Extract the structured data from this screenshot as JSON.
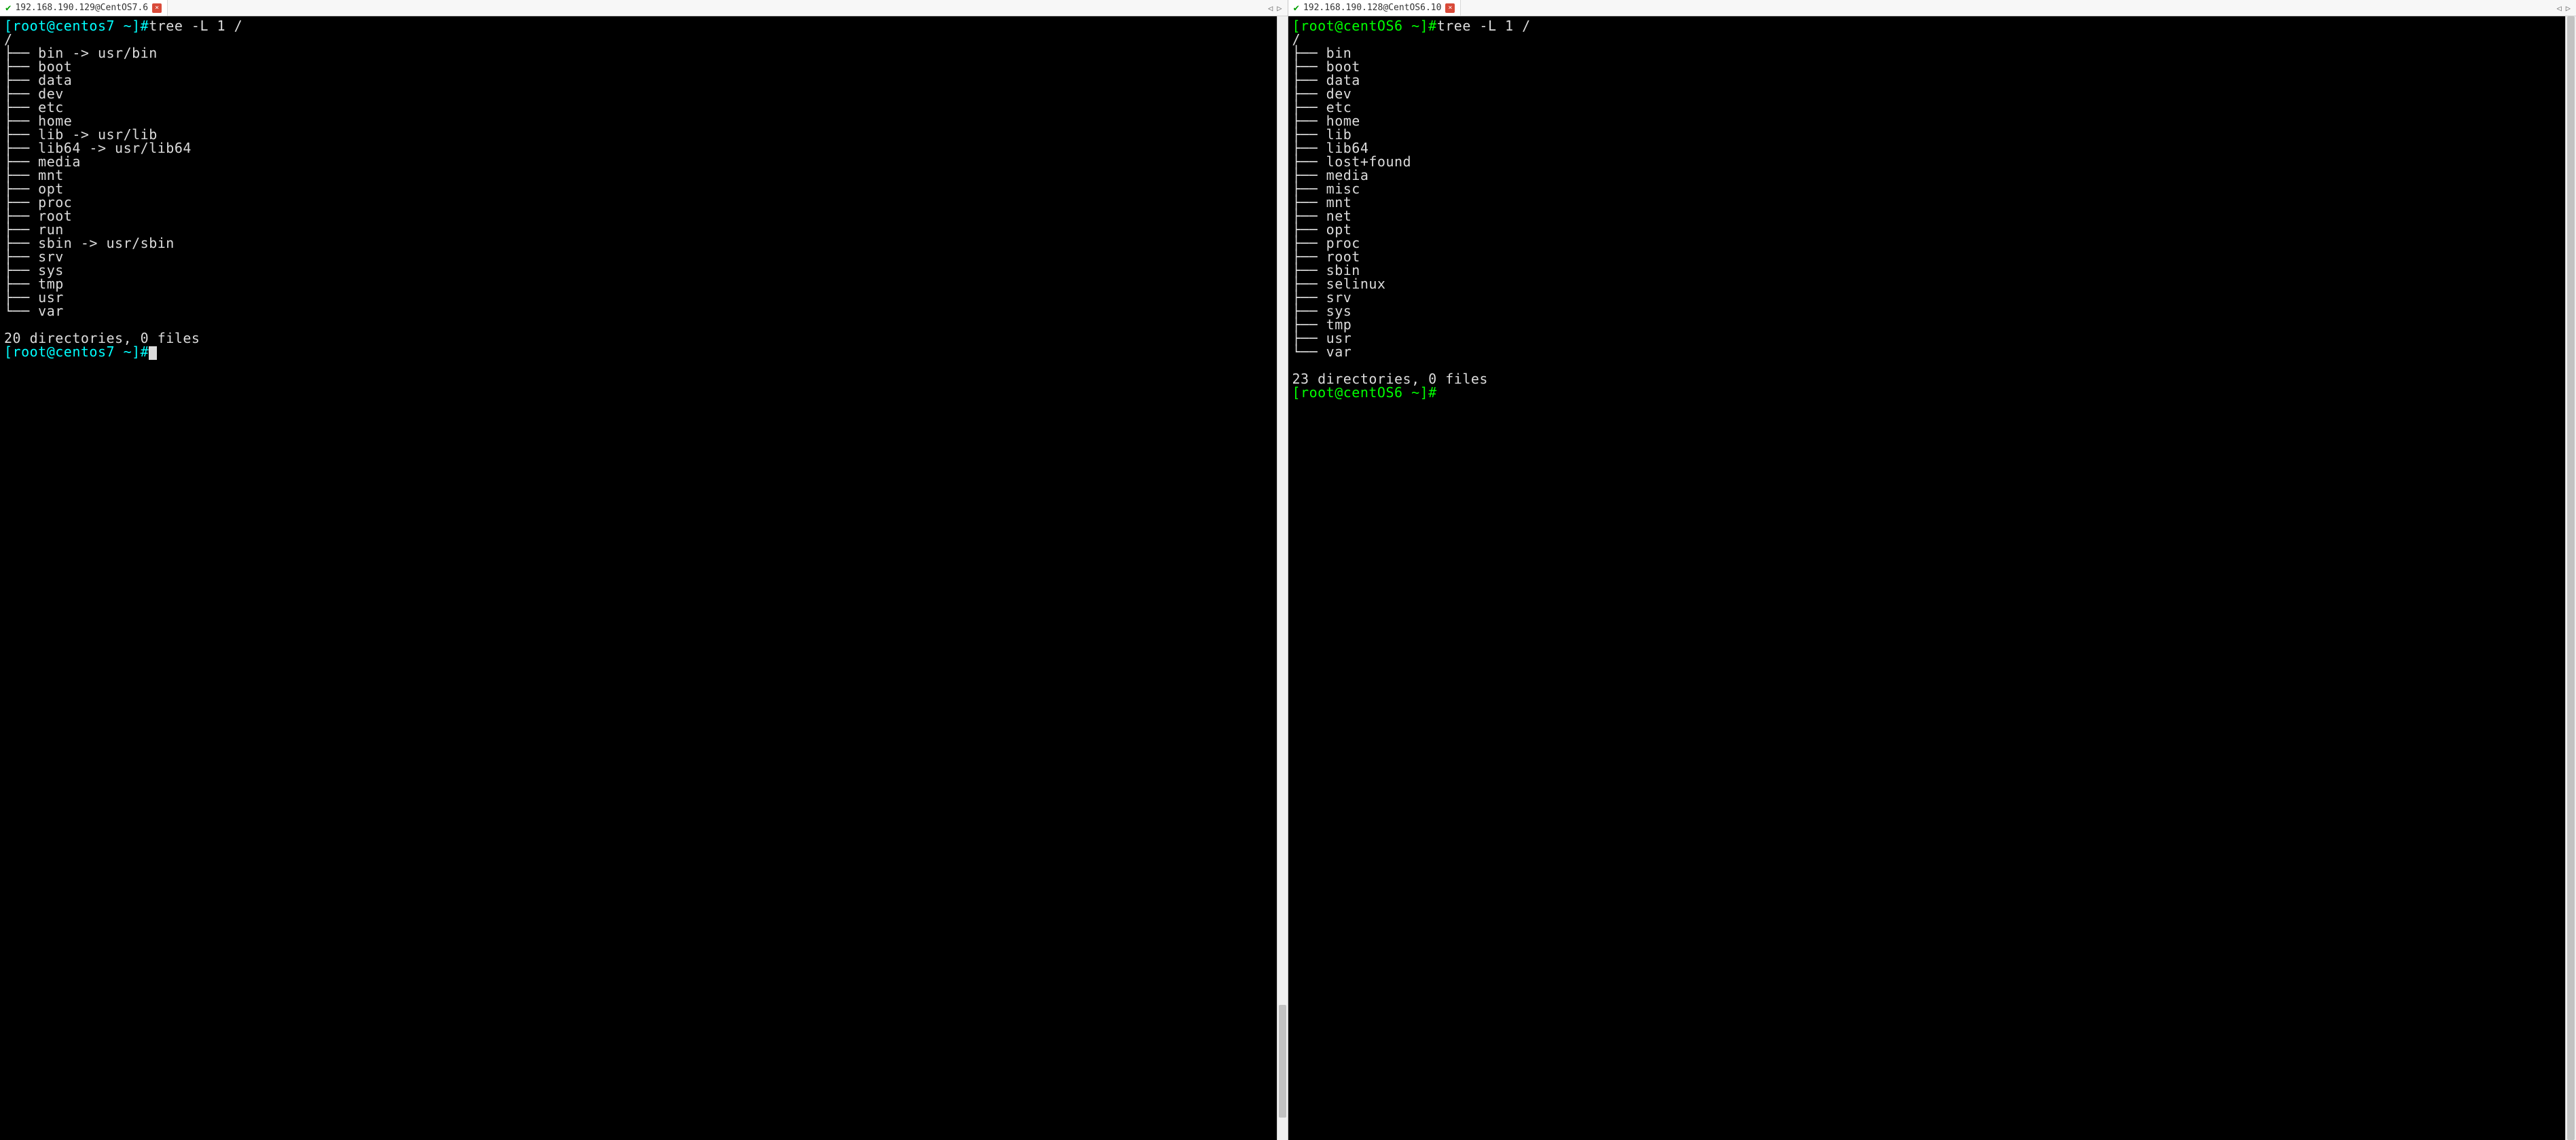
{
  "panes": [
    {
      "tab_title": "192.168.190.129@CentOS7.6",
      "prompt_color": "cyan",
      "prompt_user": "root",
      "prompt_host": "centos7",
      "prompt_path": "~",
      "command": "tree -L 1 /",
      "root_line": "/",
      "entries": [
        "bin -> usr/bin",
        "boot",
        "data",
        "dev",
        "etc",
        "home",
        "lib -> usr/lib",
        "lib64 -> usr/lib64",
        "media",
        "mnt",
        "opt",
        "proc",
        "root",
        "run",
        "sbin -> usr/sbin",
        "srv",
        "sys",
        "tmp",
        "usr",
        "var"
      ],
      "summary": "20 directories, 0 files",
      "show_cursor": true,
      "thumb_top_pct": 88,
      "thumb_height_pct": 10
    },
    {
      "tab_title": "192.168.190.128@CentOS6.10",
      "prompt_color": "green",
      "prompt_user": "root",
      "prompt_host": "centOS6",
      "prompt_path": "~",
      "command": "tree -L 1 /",
      "root_line": "/",
      "entries": [
        "bin",
        "boot",
        "data",
        "dev",
        "etc",
        "home",
        "lib",
        "lib64",
        "lost+found",
        "media",
        "misc",
        "mnt",
        "net",
        "opt",
        "proc",
        "root",
        "sbin",
        "selinux",
        "srv",
        "sys",
        "tmp",
        "usr",
        "var"
      ],
      "summary": "23 directories, 0 files",
      "show_cursor": false,
      "thumb_top_pct": 0,
      "thumb_height_pct": 100
    }
  ],
  "tree_branch_mid": "├── ",
  "tree_branch_last": "└── "
}
